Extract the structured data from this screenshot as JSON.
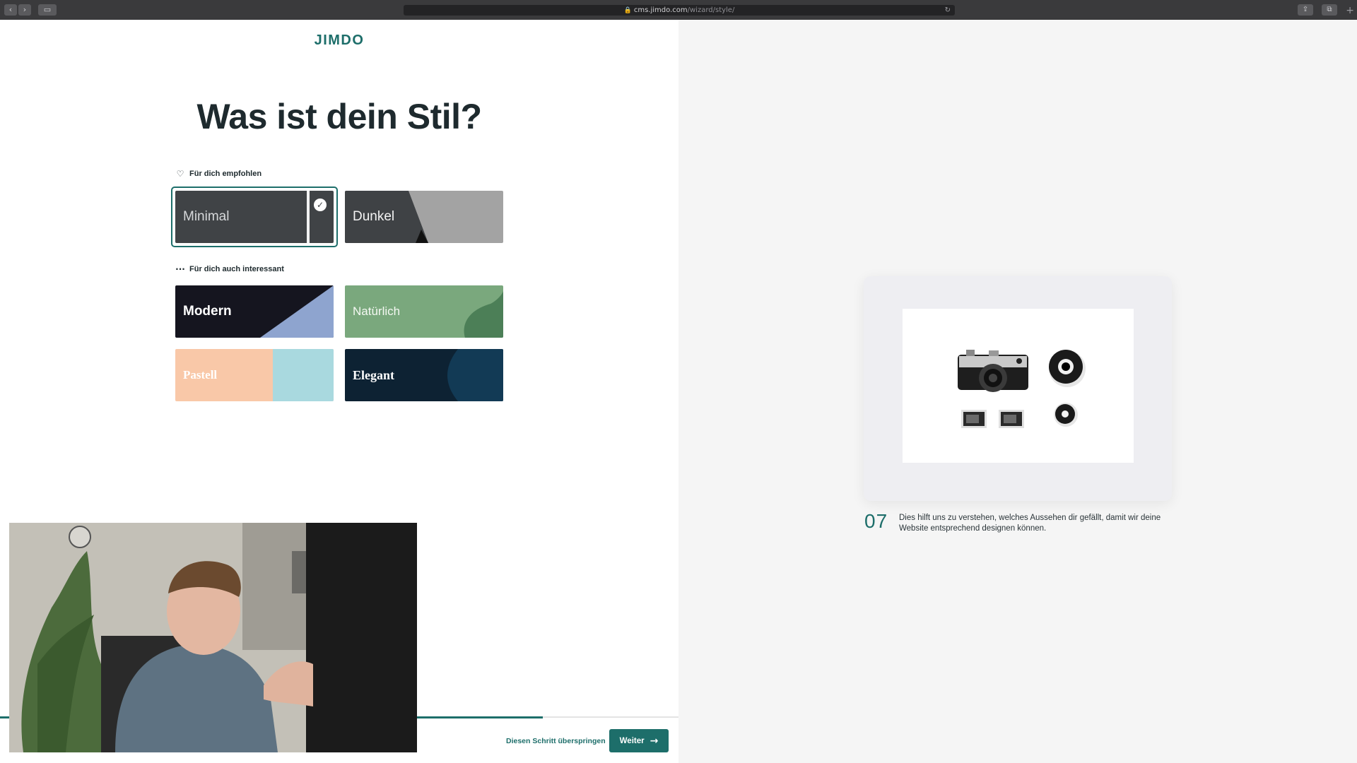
{
  "browser": {
    "url_host": "cms.jimdo.com",
    "url_path": "/wizard/style/",
    "back_icon": "chevron-left-icon",
    "forward_icon": "chevron-right-icon"
  },
  "brand": {
    "logo_text": "JIMDO",
    "color": "#1d6e6a"
  },
  "page": {
    "title": "Was ist dein Stil?"
  },
  "recommended": {
    "label": "Für dich empfohlen",
    "cards": [
      {
        "label": "Minimal",
        "selected": true
      },
      {
        "label": "Dunkel",
        "selected": false
      }
    ]
  },
  "also_interesting": {
    "label": "Für dich auch interessant",
    "cards": [
      {
        "label": "Modern"
      },
      {
        "label": "Natürlich"
      },
      {
        "label": "Pastell"
      },
      {
        "label": "Elegant"
      }
    ]
  },
  "info": {
    "step": "07",
    "text": "Dies hilft uns zu verstehen, welches Aussehen dir gefällt, damit wir deine Website entsprechend designen können."
  },
  "footer": {
    "skip_label": "Diesen Schritt überspringen",
    "next_label": "Weiter",
    "progress": 0.8
  }
}
